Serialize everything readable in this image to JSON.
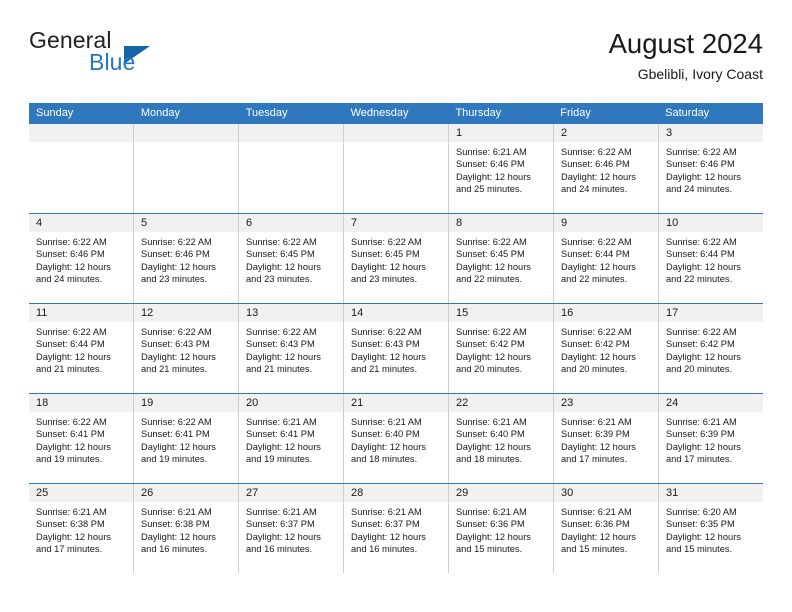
{
  "brand": {
    "name_part1": "General",
    "name_part2": "Blue",
    "triangle_icon": "triangle-icon",
    "accent_color": "#2176c7"
  },
  "header": {
    "title": "August 2024",
    "subtitle": "Gbelibli, Ivory Coast"
  },
  "colors": {
    "header_row_bg": "#2f78bd",
    "daynum_bg": "#f1f1f1",
    "cell_border": "#cfcfcf",
    "week_divider": "#2f78bd"
  },
  "weekdays": [
    "Sunday",
    "Monday",
    "Tuesday",
    "Wednesday",
    "Thursday",
    "Friday",
    "Saturday"
  ],
  "weeks": [
    [
      {
        "day": "",
        "sunrise": "",
        "sunset": "",
        "daylight1": "",
        "daylight2": "",
        "empty": true
      },
      {
        "day": "",
        "sunrise": "",
        "sunset": "",
        "daylight1": "",
        "daylight2": "",
        "empty": true
      },
      {
        "day": "",
        "sunrise": "",
        "sunset": "",
        "daylight1": "",
        "daylight2": "",
        "empty": true
      },
      {
        "day": "",
        "sunrise": "",
        "sunset": "",
        "daylight1": "",
        "daylight2": "",
        "empty": true
      },
      {
        "day": "1",
        "sunrise": "Sunrise: 6:21 AM",
        "sunset": "Sunset: 6:46 PM",
        "daylight1": "Daylight: 12 hours",
        "daylight2": "and 25 minutes."
      },
      {
        "day": "2",
        "sunrise": "Sunrise: 6:22 AM",
        "sunset": "Sunset: 6:46 PM",
        "daylight1": "Daylight: 12 hours",
        "daylight2": "and 24 minutes."
      },
      {
        "day": "3",
        "sunrise": "Sunrise: 6:22 AM",
        "sunset": "Sunset: 6:46 PM",
        "daylight1": "Daylight: 12 hours",
        "daylight2": "and 24 minutes."
      }
    ],
    [
      {
        "day": "4",
        "sunrise": "Sunrise: 6:22 AM",
        "sunset": "Sunset: 6:46 PM",
        "daylight1": "Daylight: 12 hours",
        "daylight2": "and 24 minutes."
      },
      {
        "day": "5",
        "sunrise": "Sunrise: 6:22 AM",
        "sunset": "Sunset: 6:46 PM",
        "daylight1": "Daylight: 12 hours",
        "daylight2": "and 23 minutes."
      },
      {
        "day": "6",
        "sunrise": "Sunrise: 6:22 AM",
        "sunset": "Sunset: 6:45 PM",
        "daylight1": "Daylight: 12 hours",
        "daylight2": "and 23 minutes."
      },
      {
        "day": "7",
        "sunrise": "Sunrise: 6:22 AM",
        "sunset": "Sunset: 6:45 PM",
        "daylight1": "Daylight: 12 hours",
        "daylight2": "and 23 minutes."
      },
      {
        "day": "8",
        "sunrise": "Sunrise: 6:22 AM",
        "sunset": "Sunset: 6:45 PM",
        "daylight1": "Daylight: 12 hours",
        "daylight2": "and 22 minutes."
      },
      {
        "day": "9",
        "sunrise": "Sunrise: 6:22 AM",
        "sunset": "Sunset: 6:44 PM",
        "daylight1": "Daylight: 12 hours",
        "daylight2": "and 22 minutes."
      },
      {
        "day": "10",
        "sunrise": "Sunrise: 6:22 AM",
        "sunset": "Sunset: 6:44 PM",
        "daylight1": "Daylight: 12 hours",
        "daylight2": "and 22 minutes."
      }
    ],
    [
      {
        "day": "11",
        "sunrise": "Sunrise: 6:22 AM",
        "sunset": "Sunset: 6:44 PM",
        "daylight1": "Daylight: 12 hours",
        "daylight2": "and 21 minutes."
      },
      {
        "day": "12",
        "sunrise": "Sunrise: 6:22 AM",
        "sunset": "Sunset: 6:43 PM",
        "daylight1": "Daylight: 12 hours",
        "daylight2": "and 21 minutes."
      },
      {
        "day": "13",
        "sunrise": "Sunrise: 6:22 AM",
        "sunset": "Sunset: 6:43 PM",
        "daylight1": "Daylight: 12 hours",
        "daylight2": "and 21 minutes."
      },
      {
        "day": "14",
        "sunrise": "Sunrise: 6:22 AM",
        "sunset": "Sunset: 6:43 PM",
        "daylight1": "Daylight: 12 hours",
        "daylight2": "and 21 minutes."
      },
      {
        "day": "15",
        "sunrise": "Sunrise: 6:22 AM",
        "sunset": "Sunset: 6:42 PM",
        "daylight1": "Daylight: 12 hours",
        "daylight2": "and 20 minutes."
      },
      {
        "day": "16",
        "sunrise": "Sunrise: 6:22 AM",
        "sunset": "Sunset: 6:42 PM",
        "daylight1": "Daylight: 12 hours",
        "daylight2": "and 20 minutes."
      },
      {
        "day": "17",
        "sunrise": "Sunrise: 6:22 AM",
        "sunset": "Sunset: 6:42 PM",
        "daylight1": "Daylight: 12 hours",
        "daylight2": "and 20 minutes."
      }
    ],
    [
      {
        "day": "18",
        "sunrise": "Sunrise: 6:22 AM",
        "sunset": "Sunset: 6:41 PM",
        "daylight1": "Daylight: 12 hours",
        "daylight2": "and 19 minutes."
      },
      {
        "day": "19",
        "sunrise": "Sunrise: 6:22 AM",
        "sunset": "Sunset: 6:41 PM",
        "daylight1": "Daylight: 12 hours",
        "daylight2": "and 19 minutes."
      },
      {
        "day": "20",
        "sunrise": "Sunrise: 6:21 AM",
        "sunset": "Sunset: 6:41 PM",
        "daylight1": "Daylight: 12 hours",
        "daylight2": "and 19 minutes."
      },
      {
        "day": "21",
        "sunrise": "Sunrise: 6:21 AM",
        "sunset": "Sunset: 6:40 PM",
        "daylight1": "Daylight: 12 hours",
        "daylight2": "and 18 minutes."
      },
      {
        "day": "22",
        "sunrise": "Sunrise: 6:21 AM",
        "sunset": "Sunset: 6:40 PM",
        "daylight1": "Daylight: 12 hours",
        "daylight2": "and 18 minutes."
      },
      {
        "day": "23",
        "sunrise": "Sunrise: 6:21 AM",
        "sunset": "Sunset: 6:39 PM",
        "daylight1": "Daylight: 12 hours",
        "daylight2": "and 17 minutes."
      },
      {
        "day": "24",
        "sunrise": "Sunrise: 6:21 AM",
        "sunset": "Sunset: 6:39 PM",
        "daylight1": "Daylight: 12 hours",
        "daylight2": "and 17 minutes."
      }
    ],
    [
      {
        "day": "25",
        "sunrise": "Sunrise: 6:21 AM",
        "sunset": "Sunset: 6:38 PM",
        "daylight1": "Daylight: 12 hours",
        "daylight2": "and 17 minutes."
      },
      {
        "day": "26",
        "sunrise": "Sunrise: 6:21 AM",
        "sunset": "Sunset: 6:38 PM",
        "daylight1": "Daylight: 12 hours",
        "daylight2": "and 16 minutes."
      },
      {
        "day": "27",
        "sunrise": "Sunrise: 6:21 AM",
        "sunset": "Sunset: 6:37 PM",
        "daylight1": "Daylight: 12 hours",
        "daylight2": "and 16 minutes."
      },
      {
        "day": "28",
        "sunrise": "Sunrise: 6:21 AM",
        "sunset": "Sunset: 6:37 PM",
        "daylight1": "Daylight: 12 hours",
        "daylight2": "and 16 minutes."
      },
      {
        "day": "29",
        "sunrise": "Sunrise: 6:21 AM",
        "sunset": "Sunset: 6:36 PM",
        "daylight1": "Daylight: 12 hours",
        "daylight2": "and 15 minutes."
      },
      {
        "day": "30",
        "sunrise": "Sunrise: 6:21 AM",
        "sunset": "Sunset: 6:36 PM",
        "daylight1": "Daylight: 12 hours",
        "daylight2": "and 15 minutes."
      },
      {
        "day": "31",
        "sunrise": "Sunrise: 6:20 AM",
        "sunset": "Sunset: 6:35 PM",
        "daylight1": "Daylight: 12 hours",
        "daylight2": "and 15 minutes."
      }
    ]
  ]
}
